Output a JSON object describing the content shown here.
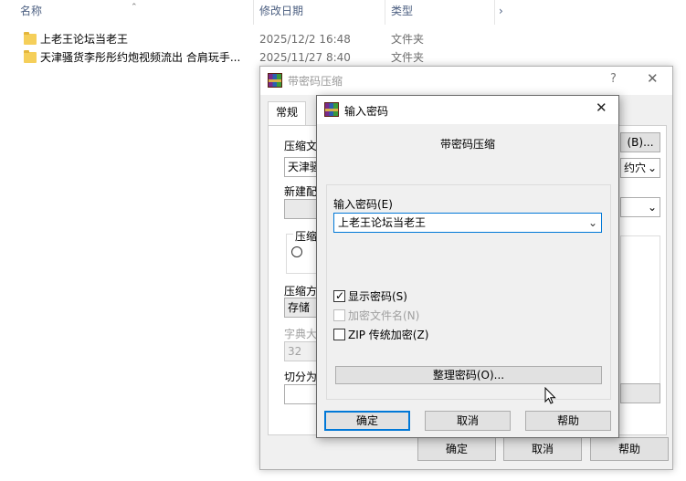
{
  "explorer": {
    "headers": {
      "name": "名称",
      "date": "修改日期",
      "type": "类型"
    },
    "files": [
      {
        "name": "上老王论坛当老王",
        "date": "2025/12/2 16:48",
        "type": "文件夹"
      },
      {
        "name": "天津骚货李彤彤约炮视频流出 合肩玩手...",
        "date": "2025/11/27 8:40",
        "type": "文件夹"
      }
    ]
  },
  "back_window": {
    "title": "带密码压缩",
    "help": "?",
    "close": "✕",
    "tab_general": "常规",
    "archive_name_label": "压缩文",
    "archive_name_value": "天津骚",
    "browse_button": "(B)...",
    "update_mode_value": "约穴",
    "profile_label": "新建配",
    "format_group": "压缩",
    "method_label": "压缩方",
    "method_value": "存储",
    "dict_label": "字典大",
    "dict_value": "32",
    "split_label": "切分为",
    "ok": "确定",
    "cancel": "取消",
    "help_btn": "帮助"
  },
  "dialog": {
    "title": "输入密码",
    "close": "✕",
    "heading": "带密码压缩",
    "password_label": "输入密码(E)",
    "password_value": "上老王论坛当老王",
    "show_password": "显示密码(S)",
    "encrypt_filenames": "加密文件名(N)",
    "zip_legacy": "ZIP 传统加密(Z)",
    "organize_button": "整理密码(O)...",
    "ok": "确定",
    "cancel": "取消",
    "help": "帮助",
    "show_password_checked": true,
    "encrypt_filenames_checked": false,
    "zip_legacy_checked": false
  }
}
